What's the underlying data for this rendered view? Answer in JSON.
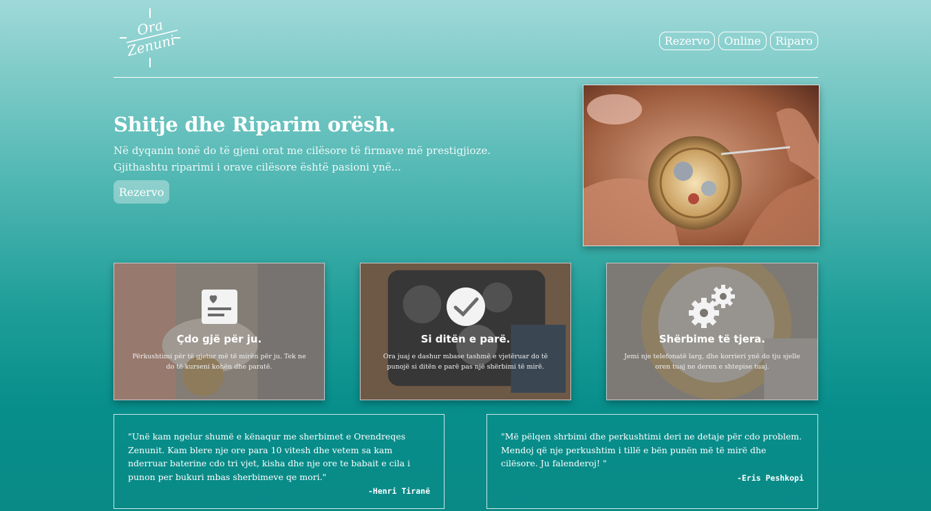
{
  "brand": {
    "logo_line1": "Ora",
    "logo_line2": "Zenuni"
  },
  "nav": {
    "items": [
      "Rezervo",
      "Online",
      "Riparo"
    ]
  },
  "hero": {
    "title": "Shitje dhe Riparim orësh.",
    "line1": "Në dyqanin tonë do të gjeni orat me cilësore të firmave më prestigjioze.",
    "line2": "Gjithashtu riparimi i orave cilësore është pasioni ynë...",
    "button": "Rezervo",
    "image": "watch-repair-photo"
  },
  "cards": [
    {
      "icon": "heart-note-icon",
      "title": "Çdo gjë për ju.",
      "text": "Përkushtimi për të gjetur më të mirën për ju. Tek ne do të kurseni kohën dhe paratë.",
      "image": "wrist-watch-photo"
    },
    {
      "icon": "checkmark-circle-icon",
      "title": "Si ditën e parë.",
      "text": "Ora juaj e dashur mbase tashmë e vjetëruar do të punojë si ditën e parë pas një shërbimi të mirë.",
      "image": "multi-dial-watch-photo"
    },
    {
      "icon": "gears-icon",
      "title": "Shërbime të tjera.",
      "text": "Jemi nje telefonatë larg, dhe korrieri ynë do tju sjelle oren tuaj ne deren e shtepise tuaj.",
      "image": "jeweled-watch-photo"
    }
  ],
  "testimonials": [
    {
      "quote": "\"Unë kam ngelur shumë e kënaqur me sherbimet e Orendreqes Zenunit. Kam blere nje ore para 10 vitesh dhe vetem sa kam nderruar baterine cdo tri vjet, kisha dhe nje ore te babait e cila i punon per bukuri mbas sherbimeve qe mori.\"",
      "author": "-Henri Tiranë"
    },
    {
      "quote": "\"Më pëlqen shrbimi dhe perkushtimi deri ne detaje për cdo problem. Mendoj që nje perkushtim i tillë e bën punën më të mirë dhe cilësore. Ju falenderoj! \"",
      "author": "-Eris Peshkopi"
    }
  ],
  "colors": {
    "gradient_top": "#9fd9d8",
    "gradient_bottom": "#0a8a87",
    "text": "#ffffff"
  }
}
